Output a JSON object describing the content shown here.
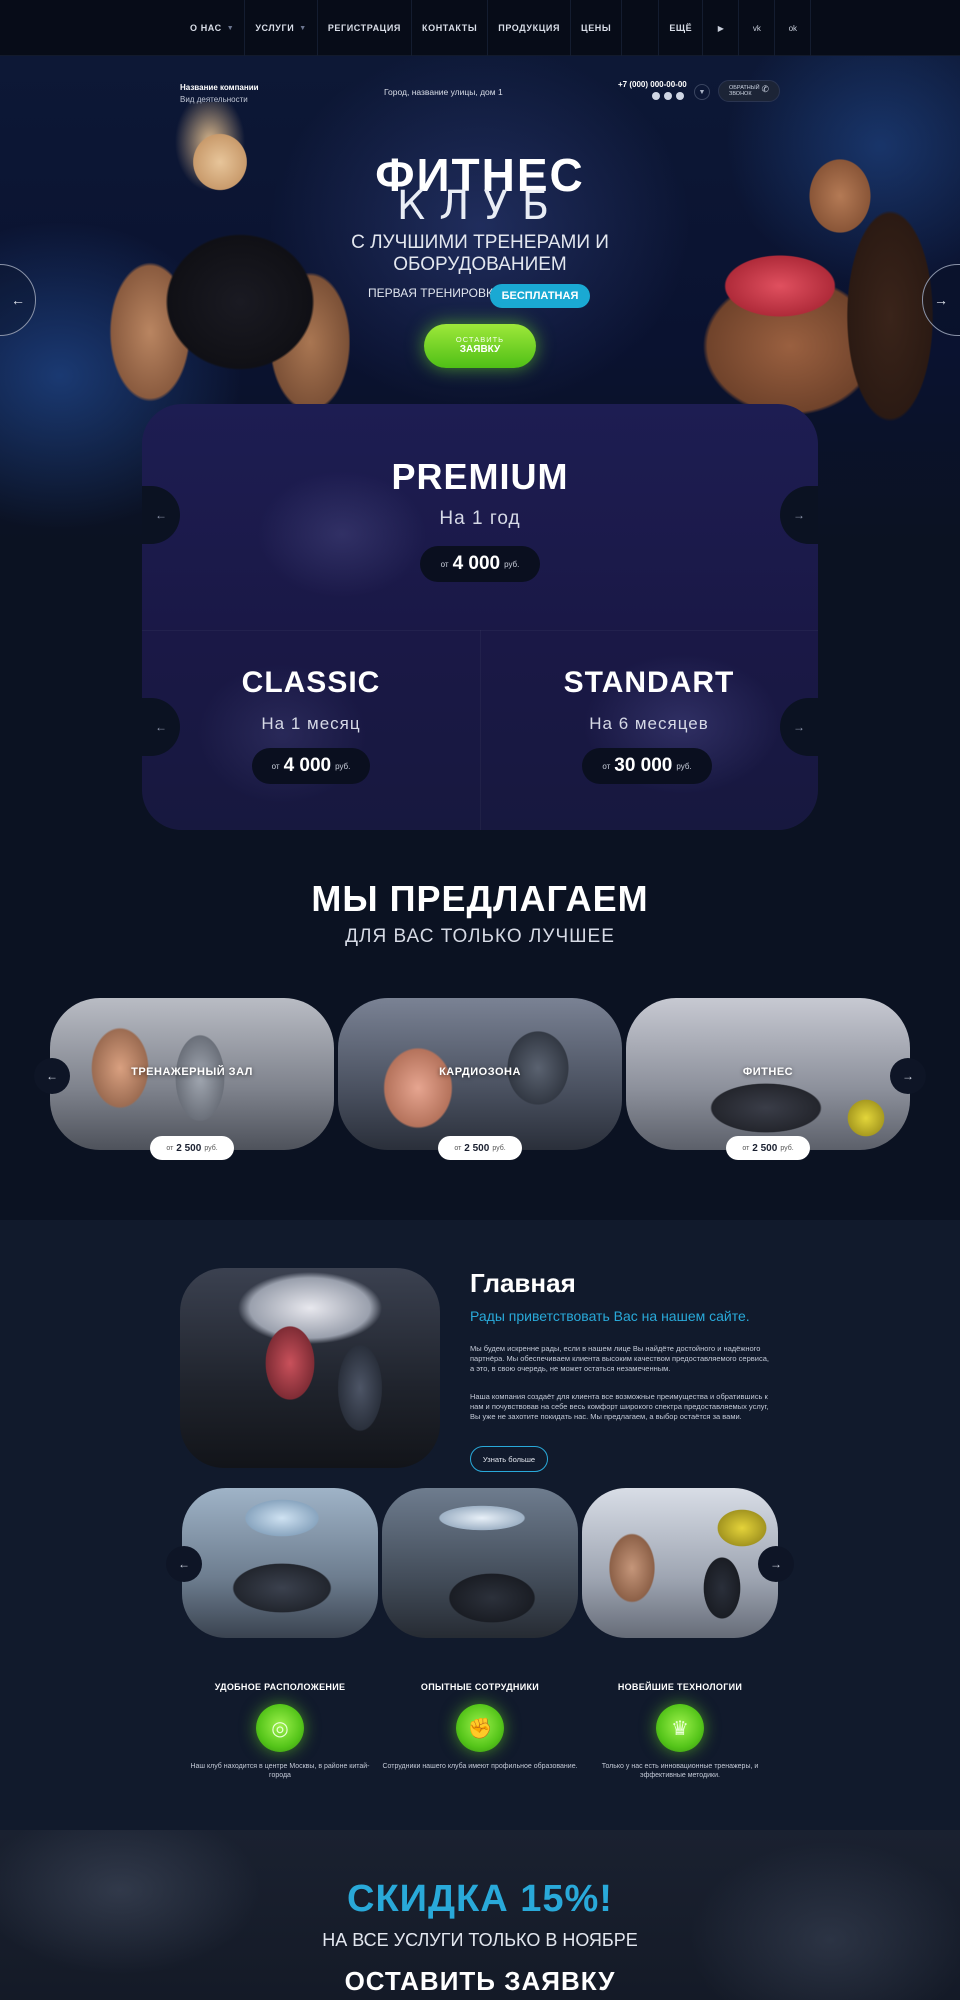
{
  "nav": {
    "items": [
      {
        "label": "О НАС",
        "dropdown": true
      },
      {
        "label": "УСЛУГИ",
        "dropdown": true
      },
      {
        "label": "РЕГИСТРАЦИЯ",
        "dropdown": false
      },
      {
        "label": "КОНТАКТЫ",
        "dropdown": false
      },
      {
        "label": "ПРОДУКЦИЯ",
        "dropdown": false
      },
      {
        "label": "ЦЕНЫ",
        "dropdown": false
      }
    ],
    "more": "ЕЩЁ",
    "social_icons": [
      "youtube-icon",
      "vk-icon",
      "odnoklassniki-icon"
    ],
    "social_glyphs": [
      "▶",
      "vk",
      "ok"
    ]
  },
  "header": {
    "company_name": "Название компании",
    "company_activity": "Вид деятельности",
    "address": "Город, название улицы, дом 1",
    "phone": "+7 (000) 000-00-00",
    "messengers": [
      "telegram-icon",
      "whatsapp-icon",
      "viber-icon"
    ],
    "callback_line1": "ОБРАТНЫЙ",
    "callback_line2": "ЗВОНОК"
  },
  "hero": {
    "title_line1": "ФИТНЕС",
    "title_line2": "КЛУБ",
    "subtitle_line1": "С ЛУЧШИМИ ТРЕНЕРАМИ И",
    "subtitle_line2": "ОБОРУДОВАНИЕМ",
    "first_training": "ПЕРВАЯ ТРЕНИРОВКА",
    "free_badge": "БЕСПЛАТНАЯ",
    "cta_line1": "ОСТАВИТЬ",
    "cta_line2": "ЗАЯВКУ"
  },
  "plans": [
    {
      "title": "PREMIUM",
      "period": "На 1 год",
      "from": "от",
      "price": "4 000",
      "currency": "руб."
    },
    {
      "title": "CLASSIC",
      "period": "На 1 месяц",
      "from": "от",
      "price": "4 000",
      "currency": "руб."
    },
    {
      "title": "STANDART",
      "period": "На 6 месяцев",
      "from": "от",
      "price": "30 000",
      "currency": "руб."
    }
  ],
  "offer": {
    "title": "МЫ ПРЕДЛАГАЕМ",
    "subtitle": "ДЛЯ ВАС ТОЛЬКО ЛУЧШЕЕ",
    "services": [
      {
        "label": "ТРЕНАЖЕРНЫЙ ЗАЛ",
        "from": "от",
        "price": "2 500",
        "currency": "руб."
      },
      {
        "label": "КАРДИОЗОНА",
        "from": "от",
        "price": "2 500",
        "currency": "руб."
      },
      {
        "label": "ФИТНЕС",
        "from": "от",
        "price": "2 500",
        "currency": "руб."
      }
    ]
  },
  "about": {
    "title": "Главная",
    "subtitle": "Рады приветствовать Вас на нашем сайте.",
    "paragraph1": "Мы будем искренне рады, если в нашем лице Вы найдёте достойного и надёжного партнёра. Мы обеспечиваем клиента высоким качеством предоставляемого сервиса, а это, в свою очередь, не может остаться незамеченным.",
    "paragraph2": "Наша компания создаёт для клиента все возможные преимущества и обратившись к нам и почувствовав на себе весь комфорт широкого спектра предоставляемых услуг, Вы уже не захотите покидать нас. Мы предлагаем, а выбор остаётся за вами.",
    "button": "Узнать больше"
  },
  "features": [
    {
      "title": "УДОБНОЕ РАСПОЛОЖЕНИЕ",
      "icon": "location-icon",
      "glyph": "◎",
      "text": "Наш клуб находится в центре Москвы, в районе китай-города"
    },
    {
      "title": "ОПЫТНЫЕ СОТРУДНИКИ",
      "icon": "muscle-icon",
      "glyph": "✊",
      "text": "Сотрудники нашего клуба имеют профильное образование."
    },
    {
      "title": "НОВЕЙШИЕ ТЕХНОЛОГИИ",
      "icon": "trophy-icon",
      "glyph": "♛",
      "text": "Только у нас есть инновационные тренажеры, и эффективные методики."
    }
  ],
  "discount": {
    "title": "СКИДКА 15%!",
    "subtitle": "НА ВСЕ УСЛУГИ ТОЛЬКО В НОЯБРЕ",
    "cta": "ОСТАВИТЬ ЗАЯВКУ"
  },
  "arrows": {
    "prev": "←",
    "next": "→"
  },
  "colors": {
    "accent_blue": "#29a9d9",
    "accent_green": "#6fd42a",
    "background": "#0b1222"
  }
}
